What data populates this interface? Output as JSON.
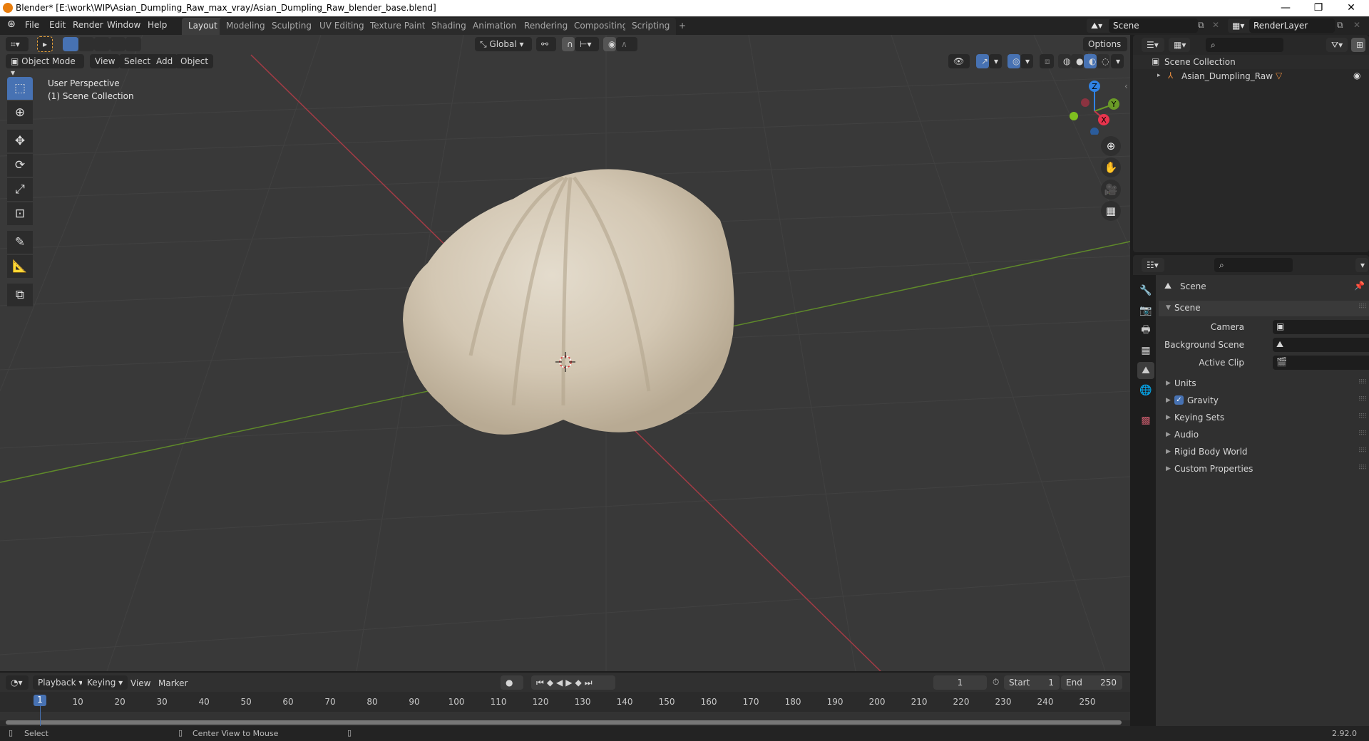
{
  "window": {
    "title": "Blender* [E:\\work\\WIP\\Asian_Dumpling_Raw_max_vray/Asian_Dumpling_Raw_blender_base.blend]",
    "controls": [
      "—",
      "❐",
      "✕"
    ]
  },
  "menu": [
    "File",
    "Edit",
    "Render",
    "Window",
    "Help"
  ],
  "workspaces": [
    {
      "label": "Layout",
      "active": true
    },
    {
      "label": "Modeling"
    },
    {
      "label": "Sculpting"
    },
    {
      "label": "UV Editing"
    },
    {
      "label": "Texture Paint"
    },
    {
      "label": "Shading"
    },
    {
      "label": "Animation"
    },
    {
      "label": "Rendering"
    },
    {
      "label": "Compositing"
    },
    {
      "label": "Scripting"
    },
    {
      "label": "+"
    }
  ],
  "scene_selector": {
    "value": "Scene"
  },
  "renderlayer_selector": {
    "value": "RenderLayer"
  },
  "viewport": {
    "transform_orientation": "Global",
    "options_label": "Options",
    "mode": "Object Mode",
    "header_menus": [
      "View",
      "Select",
      "Add",
      "Object"
    ],
    "overlay_title": "User Perspective",
    "overlay_subtitle": "(1) Scene Collection",
    "gizmo_axes": {
      "x": "X",
      "y": "Y",
      "z": "Z"
    },
    "colors": {
      "x_axis": "#c8384a",
      "y_axis": "#6a9a27",
      "z_axis": "#2f82e6",
      "active": "#4772b3"
    }
  },
  "outliner": {
    "root": "Scene Collection",
    "items": [
      {
        "name": "Asian_Dumpling_Raw",
        "visible": true
      }
    ]
  },
  "properties": {
    "context": "Scene",
    "panel_title": "Scene",
    "fields": [
      {
        "label": "Camera",
        "value": ""
      },
      {
        "label": "Background Scene",
        "value": ""
      },
      {
        "label": "Active Clip",
        "value": ""
      }
    ],
    "sections": [
      {
        "label": "Units"
      },
      {
        "label": "Gravity",
        "checked": true
      },
      {
        "label": "Keying Sets"
      },
      {
        "label": "Audio"
      },
      {
        "label": "Rigid Body World"
      },
      {
        "label": "Custom Properties"
      }
    ]
  },
  "timeline": {
    "menus": [
      "Playback",
      "Keying",
      "View",
      "Marker"
    ],
    "current_frame": "1",
    "start_label": "Start",
    "start": "1",
    "end_label": "End",
    "end": "250",
    "ticks": [
      "10",
      "20",
      "30",
      "40",
      "50",
      "60",
      "70",
      "80",
      "90",
      "100",
      "110",
      "120",
      "130",
      "140",
      "150",
      "160",
      "170",
      "180",
      "190",
      "200",
      "210",
      "220",
      "230",
      "240",
      "250"
    ],
    "playhead": "1"
  },
  "statusbar": {
    "left_action": "Select",
    "middle_action": "Center View to Mouse",
    "version": "2.92.0"
  }
}
